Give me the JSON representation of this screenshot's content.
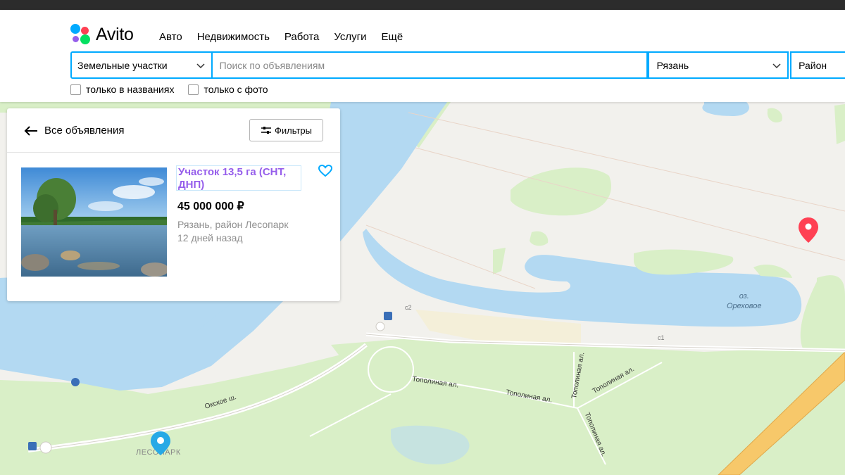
{
  "header": {
    "logo_text": "Avito",
    "nav": [
      "Авто",
      "Недвижимость",
      "Работа",
      "Услуги",
      "Ещё"
    ]
  },
  "search": {
    "category": "Земельные участки",
    "query_placeholder": "Поиск по объявлениям",
    "city": "Рязань",
    "district": "Район"
  },
  "filters": {
    "only_titles": "только в названиях",
    "only_photo": "только с фото"
  },
  "panel": {
    "back_label": "Все объявления",
    "filters_label": "Фильтры",
    "listing": {
      "title": "Участок 13,5 га (СНТ, ДНП)",
      "price": "45 000 000 ₽",
      "location": "Рязань, район Лесопарк",
      "date": "12 дней назад"
    }
  },
  "map": {
    "lake_name_1": "оз.",
    "lake_name_2": "Ореховое",
    "district_label": "ЛЕСОПАРК",
    "street_1": "Окское ш.",
    "street_2": "Тополиная ал.",
    "street_3": "Тополиная ал.",
    "street_4": "Тополиная ал.",
    "street_5": "Тополиная ал.",
    "street_6": "Тополиная ал.",
    "marker_c1": "с1",
    "marker_c2": "с2"
  },
  "colors": {
    "accent": "#00aaff",
    "title_link": "#965eeb",
    "water": "#b3d9f2",
    "park": "#d9efc7",
    "pin_red": "#ff4053",
    "pin_blue": "#27a9e6"
  }
}
